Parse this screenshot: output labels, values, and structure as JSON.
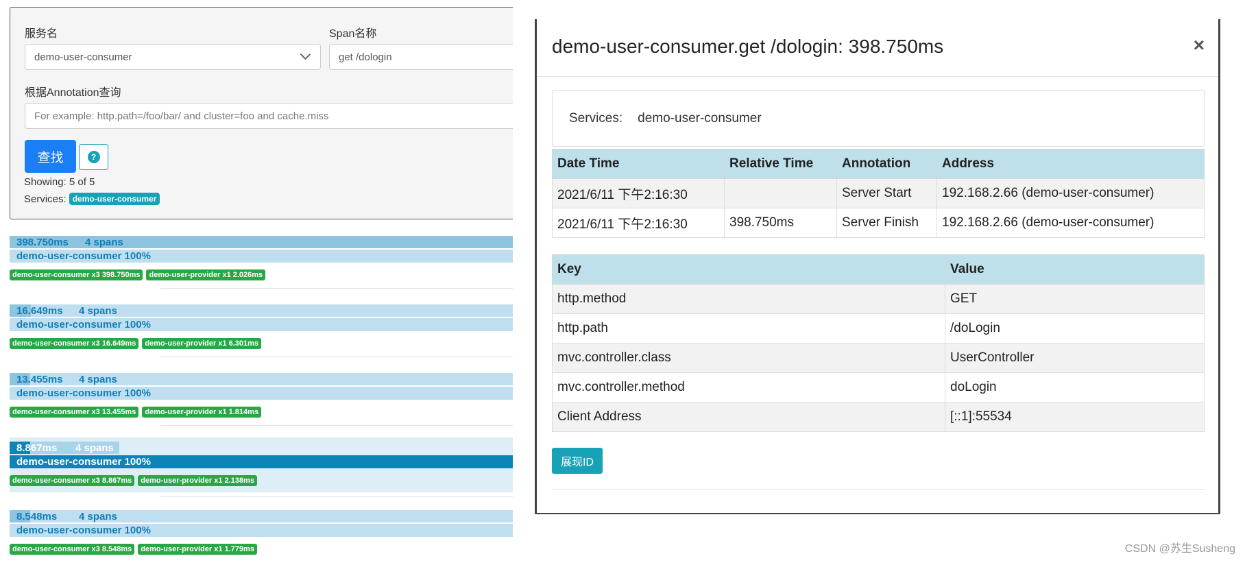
{
  "search": {
    "service_label": "服务名",
    "service_value": "demo-user-consumer",
    "span_label": "Span名称",
    "span_value": "get /dologin",
    "annotation_label": "根据Annotation查询",
    "annotation_placeholder": "For example: http.path=/foo/bar/ and cluster=foo and cache.miss",
    "search_button": "查找",
    "help_icon_text": "?",
    "showing": "Showing: 5 of 5",
    "services_label": "Services:",
    "services_badge": "demo-user-consumer"
  },
  "traces": [
    {
      "duration": "398.750ms",
      "spans": "4 spans",
      "service_pct": "demo-user-consumer 100%",
      "fill": 1.0,
      "tags": [
        "demo-user-consumer x3 398.750ms",
        "demo-user-provider x1 2.026ms"
      ]
    },
    {
      "duration": "16.649ms",
      "spans": "4 spans",
      "service_pct": "demo-user-consumer 100%",
      "fill": 0.0418,
      "tags": [
        "demo-user-consumer x3 16.649ms",
        "demo-user-provider x1 6.301ms"
      ]
    },
    {
      "duration": "13.455ms",
      "spans": "4 spans",
      "service_pct": "demo-user-consumer 100%",
      "fill": 0.0337,
      "tags": [
        "demo-user-consumer x3 13.455ms",
        "demo-user-provider x1 1.814ms"
      ]
    },
    {
      "duration": "8.867ms",
      "spans": "4 spans",
      "service_pct": "demo-user-consumer 100%",
      "fill": 0.0222,
      "tags": [
        "demo-user-consumer x3 8.867ms",
        "demo-user-provider x1 2.138ms"
      ]
    },
    {
      "duration": "8.548ms",
      "spans": "4 spans",
      "service_pct": "demo-user-consumer 100%",
      "fill": 0.0214,
      "tags": [
        "demo-user-consumer x3 8.548ms",
        "demo-user-provider x1 1.779ms"
      ]
    }
  ],
  "modal": {
    "title": "demo-user-consumer.get /dologin: 398.750ms",
    "close": "×",
    "services_key": "Services:",
    "services_value": "demo-user-consumer",
    "annotations": {
      "headers": [
        "Date Time",
        "Relative Time",
        "Annotation",
        "Address"
      ],
      "rows": [
        [
          "2021/6/11 下午2:16:30",
          "",
          "Server Start",
          "192.168.2.66 (demo-user-consumer)"
        ],
        [
          "2021/6/11 下午2:16:30",
          "398.750ms",
          "Server Finish",
          "192.168.2.66 (demo-user-consumer)"
        ]
      ]
    },
    "tags": {
      "headers": [
        "Key",
        "Value"
      ],
      "rows": [
        [
          "http.method",
          "GET"
        ],
        [
          "http.path",
          "/doLogin"
        ],
        [
          "mvc.controller.class",
          "UserController"
        ],
        [
          "mvc.controller.method",
          "doLogin"
        ],
        [
          "Client Address",
          "[::1]:55534"
        ]
      ]
    },
    "show_ids_button": "展现ID"
  },
  "watermark": "CSDN @苏生Susheng",
  "colors": {
    "primary": "#1a7ef6",
    "info": "#17a2b8",
    "success": "#28a745",
    "bar": "#bfdff0",
    "bar_active": "#0d84b8"
  }
}
